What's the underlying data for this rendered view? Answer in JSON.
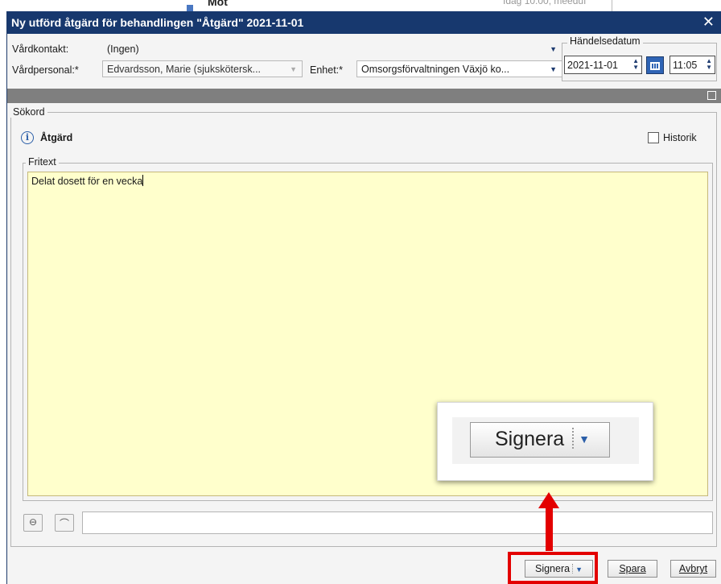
{
  "background_window": {
    "title_fragment": "Möt",
    "time_fragment": "Idag 10:00, meeduf"
  },
  "dialog": {
    "title": "Ny utförd åtgärd för behandlingen \"Åtgärd\" 2021-11-01",
    "close_glyph": "✕"
  },
  "form": {
    "vardkontakt_label": "Vårdkontakt:",
    "vardkontakt_value": "(Ingen)",
    "vardpersonal_label": "Vårdpersonal:*",
    "vardpersonal_value": "Edvardsson, Marie (sjuksköt­ersk...",
    "enhet_label": "Enhet:*",
    "enhet_value": "Omsorgsförvaltningen Växjö ko...",
    "handelsedatum_label": "Händelsedatum",
    "date_value": "2021-11-01",
    "time_value": "11:05"
  },
  "sokord": {
    "group_label": "Sökord",
    "term_label": "Åtgärd",
    "historik_label": "Historik",
    "historik_checked": false
  },
  "fritext": {
    "group_label": "Fritext",
    "text": "Delat dosett för en vecka"
  },
  "buttons": {
    "signera": "Signera",
    "spara": "Spara",
    "avbryt": "Avbryt"
  },
  "callout": {
    "label": "Signera"
  },
  "colors": {
    "titlebar": "#17386e",
    "textarea_bg": "#ffffcc",
    "highlight_red": "#e30000"
  }
}
